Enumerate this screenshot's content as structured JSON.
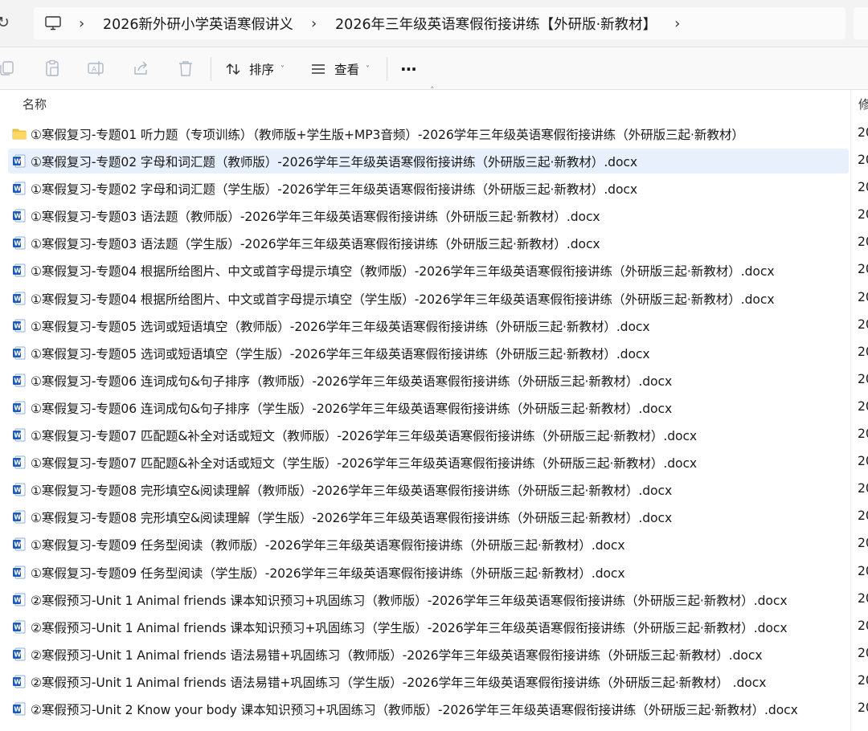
{
  "window": {
    "breadcrumb": [
      "2026新外研小学英语寒假讲义",
      "2026年三年级英语寒假衔接讲练【外研版·新教材】"
    ]
  },
  "toolbar": {
    "sort_label": "排序",
    "view_label": "查看",
    "more_label": "···"
  },
  "columns": {
    "name": "名称",
    "modified": "修"
  },
  "files": [
    {
      "type": "folder",
      "name": "①寒假复习-专题01 听力题（专项训练）（教师版+学生版+MP3音频）-2026学年三年级英语寒假衔接讲练（外研版三起·新教材）",
      "date": "20"
    },
    {
      "type": "docx",
      "name": "①寒假复习-专题02 字母和词汇题（教师版）-2026学年三年级英语寒假衔接讲练（外研版三起·新教材）.docx",
      "date": "20",
      "selected": true
    },
    {
      "type": "docx",
      "name": "①寒假复习-专题02 字母和词汇题（学生版）-2026学年三年级英语寒假衔接讲练（外研版三起·新教材）.docx",
      "date": "20"
    },
    {
      "type": "docx",
      "name": "①寒假复习-专题03 语法题（教师版）-2026学年三年级英语寒假衔接讲练（外研版三起·新教材）.docx",
      "date": "20"
    },
    {
      "type": "docx",
      "name": "①寒假复习-专题03 语法题（学生版）-2026学年三年级英语寒假衔接讲练（外研版三起·新教材）.docx",
      "date": "20"
    },
    {
      "type": "docx",
      "name": "①寒假复习-专题04 根据所给图片、中文或首字母提示填空（教师版）-2026学年三年级英语寒假衔接讲练（外研版三起·新教材）.docx",
      "date": "20"
    },
    {
      "type": "docx",
      "name": "①寒假复习-专题04 根据所给图片、中文或首字母提示填空（学生版）-2026学年三年级英语寒假衔接讲练（外研版三起·新教材）.docx",
      "date": "20"
    },
    {
      "type": "docx",
      "name": "①寒假复习-专题05 选词或短语填空（教师版）-2026学年三年级英语寒假衔接讲练（外研版三起·新教材）.docx",
      "date": "20"
    },
    {
      "type": "docx",
      "name": "①寒假复习-专题05 选词或短语填空（学生版）-2026学年三年级英语寒假衔接讲练（外研版三起·新教材）.docx",
      "date": "20"
    },
    {
      "type": "docx",
      "name": "①寒假复习-专题06 连词成句&句子排序（教师版）-2026学年三年级英语寒假衔接讲练（外研版三起·新教材）.docx",
      "date": "20"
    },
    {
      "type": "docx",
      "name": "①寒假复习-专题06 连词成句&句子排序（学生版）-2026学年三年级英语寒假衔接讲练（外研版三起·新教材）.docx",
      "date": "20"
    },
    {
      "type": "docx",
      "name": "①寒假复习-专题07 匹配题&补全对话或短文（教师版）-2026学年三年级英语寒假衔接讲练（外研版三起·新教材）.docx",
      "date": "20"
    },
    {
      "type": "docx",
      "name": "①寒假复习-专题07 匹配题&补全对话或短文（学生版）-2026学年三年级英语寒假衔接讲练（外研版三起·新教材）.docx",
      "date": "20"
    },
    {
      "type": "docx",
      "name": "①寒假复习-专题08 完形填空&阅读理解（教师版）-2026学年三年级英语寒假衔接讲练（外研版三起·新教材）.docx",
      "date": "20"
    },
    {
      "type": "docx",
      "name": "①寒假复习-专题08 完形填空&阅读理解（学生版）-2026学年三年级英语寒假衔接讲练（外研版三起·新教材）.docx",
      "date": "20"
    },
    {
      "type": "docx",
      "name": "①寒假复习-专题09 任务型阅读（教师版）-2026学年三年级英语寒假衔接讲练（外研版三起·新教材）.docx",
      "date": "20"
    },
    {
      "type": "docx",
      "name": "①寒假复习-专题09 任务型阅读（学生版）-2026学年三年级英语寒假衔接讲练（外研版三起·新教材）.docx",
      "date": "20"
    },
    {
      "type": "docx",
      "name": "②寒假预习-Unit 1 Animal friends 课本知识预习+巩固练习（教师版）-2026学年三年级英语寒假衔接讲练（外研版三起·新教材）.docx",
      "date": "20"
    },
    {
      "type": "docx",
      "name": "②寒假预习-Unit 1 Animal friends 课本知识预习+巩固练习（学生版）-2026学年三年级英语寒假衔接讲练（外研版三起·新教材）.docx",
      "date": "20"
    },
    {
      "type": "docx",
      "name": "②寒假预习-Unit 1 Animal friends 语法易错+巩固练习（教师版）-2026学年三年级英语寒假衔接讲练（外研版三起·新教材）.docx",
      "date": "20"
    },
    {
      "type": "docx",
      "name": "②寒假预习-Unit 1 Animal friends 语法易错+巩固练习（学生版）-2026学年三年级英语寒假衔接讲练（外研版三起·新教材） .docx",
      "date": "20"
    },
    {
      "type": "docx",
      "name": "②寒假预习-Unit 2 Know your body 课本知识预习+巩固练习（教师版）-2026学年三年级英语寒假衔接讲练（外研版三起·新教材）.docx",
      "date": "20"
    }
  ]
}
